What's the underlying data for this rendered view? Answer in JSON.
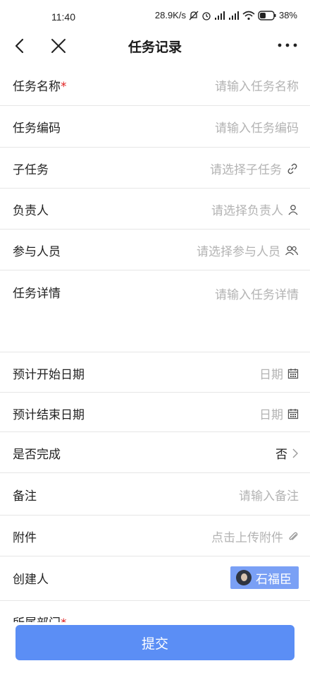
{
  "status": {
    "time": "11:40",
    "net_speed": "28.9K/s",
    "battery": "38%"
  },
  "nav": {
    "title": "任务记录",
    "back_icon": "chevron-left-icon",
    "close_icon": "close-icon",
    "more_icon": "more-dots-icon"
  },
  "form": {
    "task_name": {
      "label": "任务名称",
      "required_mark": "*",
      "placeholder": "请输入任务名称"
    },
    "task_code": {
      "label": "任务编码",
      "placeholder": "请输入任务编码"
    },
    "sub_task": {
      "label": "子任务",
      "placeholder": "请选择子任务",
      "icon": "link-icon"
    },
    "owner": {
      "label": "负责人",
      "placeholder": "请选择负责人",
      "icon": "user-icon"
    },
    "participants": {
      "label": "参与人员",
      "placeholder": "请选择参与人员",
      "icon": "users-icon"
    },
    "details": {
      "label": "任务详情",
      "placeholder": "请输入任务详情"
    },
    "start_date": {
      "label": "预计开始日期",
      "placeholder": "日期",
      "icon": "calendar-icon"
    },
    "end_date": {
      "label": "预计结束日期",
      "placeholder": "日期",
      "icon": "calendar-icon"
    },
    "completed": {
      "label": "是否完成",
      "value": "否",
      "icon": "chevron-right-icon"
    },
    "remarks": {
      "label": "备注",
      "placeholder": "请输入备注"
    },
    "attachment": {
      "label": "附件",
      "placeholder": "点击上传附件",
      "icon": "paperclip-icon"
    },
    "creator": {
      "label": "创建人",
      "value": "石福臣"
    },
    "department": {
      "label": "所属部门",
      "required_mark": "*"
    }
  },
  "submit": {
    "label": "提交"
  },
  "colors": {
    "accent": "#5b8ef5",
    "chip": "#7aa0f5",
    "required": "#e02020",
    "placeholder": "#b3b3b3",
    "divider": "#e6e6e6"
  }
}
